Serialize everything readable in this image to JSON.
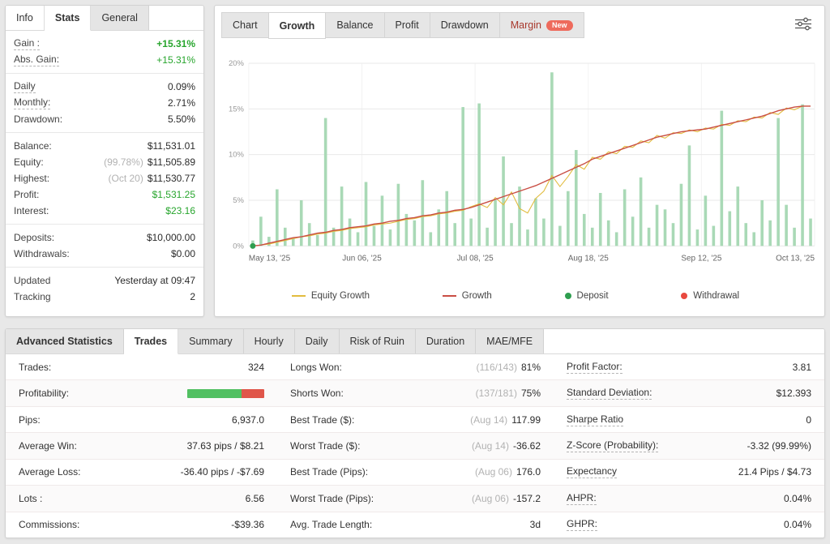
{
  "colors": {
    "positive": "#27a52d",
    "negative": "#d9534f",
    "bar_green": "#52c062",
    "bar_red": "#e0564a",
    "margin_tab_text": "#a8382c"
  },
  "stats_panel": {
    "tabs": [
      {
        "label": "Info"
      },
      {
        "label": "Stats",
        "active": true
      },
      {
        "label": "General",
        "gray": true
      }
    ],
    "groups": [
      [
        {
          "label": "Gain :",
          "u": true,
          "value": "+15.31%",
          "color": "green",
          "bold": true
        },
        {
          "label": "Abs. Gain:",
          "u": true,
          "value": "+15.31%",
          "color": "green"
        }
      ],
      [
        {
          "label": "Daily",
          "u": true,
          "value": "0.09%"
        },
        {
          "label": "Monthly:",
          "u": true,
          "value": "2.71%"
        },
        {
          "label": "Drawdown:",
          "value": "5.50%"
        }
      ],
      [
        {
          "label": "Balance:",
          "value": "$11,531.01"
        },
        {
          "label": "Equity:",
          "prefix": "(99.78%)",
          "value": "$11,505.89"
        },
        {
          "label": "Highest:",
          "prefix": "(Oct 20)",
          "value": "$11,530.77"
        },
        {
          "label": "Profit:",
          "value": "$1,531.25",
          "color": "green"
        },
        {
          "label": "Interest:",
          "value": "$23.16",
          "color": "green"
        }
      ],
      [
        {
          "label": "Deposits:",
          "value": "$10,000.00"
        },
        {
          "label": "Withdrawals:",
          "value": "$0.00"
        }
      ],
      [
        {
          "label": "Updated",
          "value": "Yesterday at 09:47"
        },
        {
          "label": "Tracking",
          "value": "2"
        }
      ]
    ]
  },
  "chart_panel": {
    "tabs": [
      {
        "label": "Chart",
        "gray": true
      },
      {
        "label": "Growth",
        "active": true
      },
      {
        "label": "Balance",
        "gray": true
      },
      {
        "label": "Profit",
        "gray": true
      },
      {
        "label": "Drawdown",
        "gray": true
      },
      {
        "label": "Margin",
        "gray": true,
        "color": "#a8382c",
        "badge": "New"
      }
    ],
    "legend": [
      {
        "label": "Equity Growth",
        "swatch": "line",
        "color": "#e2bc3f"
      },
      {
        "label": "Growth",
        "swatch": "line",
        "color": "#c94e44"
      },
      {
        "label": "Deposit",
        "swatch": "dot",
        "color": "#2f9e4f"
      },
      {
        "label": "Withdrawal",
        "swatch": "dot",
        "color": "#e8493f"
      }
    ],
    "chart_data": {
      "type": "bar+line",
      "ylim": [
        0,
        20
      ],
      "y_ticks": [
        {
          "v": 0,
          "label": "0%"
        },
        {
          "v": 5,
          "label": "5%"
        },
        {
          "v": 10,
          "label": "10%"
        },
        {
          "v": 15,
          "label": "15%"
        },
        {
          "v": 20,
          "label": "20%"
        }
      ],
      "x_axis_labels": [
        "May 13, '25",
        "Jun 06, '25",
        "Jul 08, '25",
        "Aug 18, '25",
        "Sep 12, '25",
        "Oct 13, '25"
      ],
      "series": [
        {
          "name": "Daily Gain",
          "type": "bar",
          "color": "#a9d9b6",
          "values": [
            0.6,
            3.2,
            1.0,
            6.2,
            2.0,
            0.8,
            5.0,
            2.5,
            1.2,
            14.0,
            2.0,
            6.5,
            3.0,
            1.5,
            7.0,
            2.2,
            5.5,
            1.8,
            6.8,
            3.5,
            2.8,
            7.2,
            1.5,
            4.0,
            6.0,
            2.5,
            15.2,
            3.0,
            15.6,
            2.0,
            5.0,
            9.8,
            2.5,
            6.5,
            1.8,
            5.2,
            3.0,
            19.0,
            2.2,
            6.0,
            10.5,
            3.5,
            2.0,
            5.8,
            2.8,
            1.5,
            6.2,
            3.2,
            7.5,
            2.0,
            4.5,
            4.0,
            2.5,
            6.8,
            11.0,
            1.8,
            5.5,
            2.2,
            14.8,
            3.8,
            6.5,
            2.5,
            1.5,
            5.0,
            2.8,
            14.0,
            4.5,
            2.0,
            15.5,
            3.0
          ]
        },
        {
          "name": "Equity Growth",
          "type": "line",
          "color": "#e2bc3f",
          "values": [
            0,
            0.1,
            0.2,
            0.4,
            0.6,
            0.8,
            1.0,
            1.1,
            1.3,
            1.4,
            1.6,
            1.7,
            1.9,
            2.0,
            2.1,
            2.3,
            2.4,
            2.5,
            2.7,
            2.9,
            3.0,
            3.2,
            3.3,
            3.5,
            3.6,
            3.8,
            3.9,
            4.3,
            4.6,
            4.2,
            5.3,
            4.5,
            5.9,
            4.1,
            3.6,
            5.2,
            6.0,
            7.7,
            6.5,
            7.6,
            8.9,
            8.4,
            9.7,
            9.5,
            10.3,
            10.1,
            10.9,
            10.8,
            11.5,
            11.3,
            12.1,
            11.8,
            12.4,
            12.3,
            12.7,
            12.5,
            12.9,
            12.8,
            13.3,
            13.2,
            13.7,
            13.6,
            14.1,
            14.0,
            14.6,
            14.4,
            15.1,
            14.9,
            15.3,
            15.3
          ]
        },
        {
          "name": "Growth",
          "type": "line",
          "color": "#c94e44",
          "values": [
            0,
            0.1,
            0.3,
            0.5,
            0.7,
            0.9,
            1.0,
            1.2,
            1.4,
            1.5,
            1.7,
            1.8,
            2.0,
            2.1,
            2.2,
            2.4,
            2.5,
            2.7,
            2.8,
            3.0,
            3.1,
            3.3,
            3.4,
            3.6,
            3.7,
            3.9,
            4.0,
            4.2,
            4.5,
            4.8,
            5.1,
            5.4,
            5.7,
            6.0,
            6.3,
            6.6,
            7.0,
            7.4,
            7.8,
            8.2,
            8.6,
            9.0,
            9.5,
            9.8,
            10.1,
            10.4,
            10.7,
            11.0,
            11.3,
            11.6,
            11.9,
            12.1,
            12.3,
            12.5,
            12.6,
            12.7,
            12.8,
            13.0,
            13.2,
            13.4,
            13.6,
            13.8,
            14.0,
            14.2,
            14.5,
            14.8,
            15.0,
            15.2,
            15.3,
            15.3
          ]
        }
      ],
      "markers": [
        {
          "name": "Deposit",
          "index": 0,
          "value": 0,
          "color": "#2f9e4f"
        }
      ]
    }
  },
  "bottom_panel": {
    "tabs": [
      {
        "label": "Advanced Statistics",
        "gray": true,
        "bold": true
      },
      {
        "label": "Trades",
        "active": true
      },
      {
        "label": "Summary",
        "gray": true
      },
      {
        "label": "Hourly",
        "gray": true
      },
      {
        "label": "Daily",
        "gray": true
      },
      {
        "label": "Risk of Ruin",
        "gray": true
      },
      {
        "label": "Duration",
        "gray": true
      },
      {
        "label": "MAE/MFE",
        "gray": true
      }
    ],
    "table": {
      "columns": [
        [
          {
            "label": "Trades:",
            "value": "324"
          },
          {
            "label": "Profitability:",
            "type": "bar",
            "green_pct": 70,
            "red_pct": 30
          },
          {
            "label": "Pips:",
            "value": "6,937.0"
          },
          {
            "label": "Average Win:",
            "value": "37.63 pips / $8.21"
          },
          {
            "label": "Average Loss:",
            "value": "-36.40 pips / -$7.69"
          },
          {
            "label": "Lots :",
            "value": "6.56"
          },
          {
            "label": "Commissions:",
            "value": "-$39.36"
          }
        ],
        [
          {
            "label": "Longs Won:",
            "prefix": "(116/143)",
            "value": "81%"
          },
          {
            "label": "Shorts Won:",
            "prefix": "(137/181)",
            "value": "75%"
          },
          {
            "label": "Best Trade ($):",
            "prefix": "(Aug 14)",
            "value": "117.99"
          },
          {
            "label": "Worst Trade ($):",
            "prefix": "(Aug 14)",
            "value": "-36.62"
          },
          {
            "label": "Best Trade (Pips):",
            "prefix": "(Aug 06)",
            "value": "176.0"
          },
          {
            "label": "Worst Trade (Pips):",
            "prefix": "(Aug 06)",
            "value": "-157.2"
          },
          {
            "label": "Avg. Trade Length:",
            "value": "3d"
          }
        ],
        [
          {
            "label": "Profit Factor:",
            "u": true,
            "value": "3.81"
          },
          {
            "label": "Standard Deviation:",
            "u": true,
            "value": "$12.393"
          },
          {
            "label": "Sharpe Ratio",
            "u": true,
            "value": "0"
          },
          {
            "label": "Z-Score (Probability):",
            "u": true,
            "value": "-3.32 (99.99%)"
          },
          {
            "label": "Expectancy",
            "u": true,
            "value": "21.4 Pips / $4.73"
          },
          {
            "label": "AHPR:",
            "u": true,
            "value": "0.04%"
          },
          {
            "label": "GHPR:",
            "u": true,
            "value": "0.04%"
          }
        ]
      ]
    }
  }
}
